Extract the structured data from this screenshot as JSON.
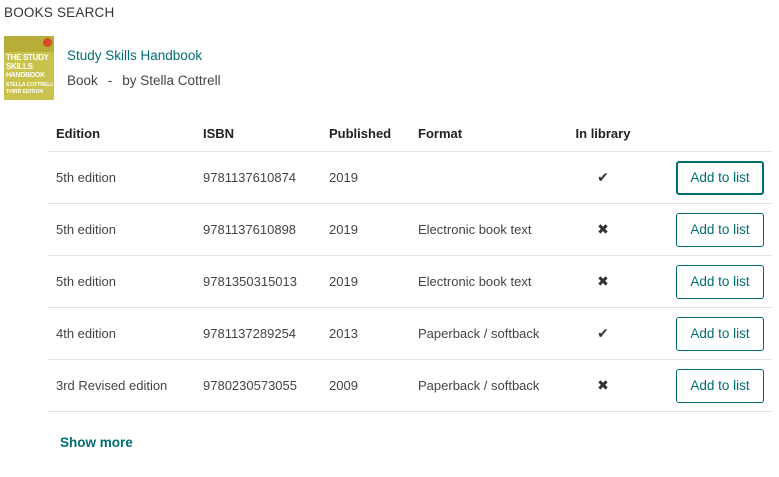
{
  "section_title": "BOOKS SEARCH",
  "book": {
    "cover": {
      "title_lines": [
        "THE STUDY",
        "SKILLS",
        "HANDBOOK"
      ],
      "author": "STELLA COTTRELL",
      "edition": "THIRD EDITION",
      "color": "#c9c24d"
    },
    "title": "Study Skills Handbook",
    "type": "Book",
    "separator": "-",
    "author": "by Stella Cottrell"
  },
  "table": {
    "headers": {
      "edition": "Edition",
      "isbn": "ISBN",
      "published": "Published",
      "format": "Format",
      "in_library": "In library"
    },
    "rows": [
      {
        "edition": "5th edition",
        "isbn": "9781137610874",
        "published": "2019",
        "format": "",
        "in_library": "✔",
        "button": "Add to list"
      },
      {
        "edition": "5th edition",
        "isbn": "9781137610898",
        "published": "2019",
        "format": "Electronic book text",
        "in_library": "✖",
        "button": "Add to list"
      },
      {
        "edition": "5th edition",
        "isbn": "9781350315013",
        "published": "2019",
        "format": "Electronic book text",
        "in_library": "✖",
        "button": "Add to list"
      },
      {
        "edition": "4th edition",
        "isbn": "9781137289254",
        "published": "2013",
        "format": "Paperback / softback",
        "in_library": "✔",
        "button": "Add to list"
      },
      {
        "edition": "3rd Revised edition",
        "isbn": "9780230573055",
        "published": "2009",
        "format": "Paperback / softback",
        "in_library": "✖",
        "button": "Add to list"
      }
    ]
  },
  "show_more": "Show more",
  "colors": {
    "accent": "#006d74",
    "text": "#444444",
    "divider": "#e2e2e2"
  }
}
